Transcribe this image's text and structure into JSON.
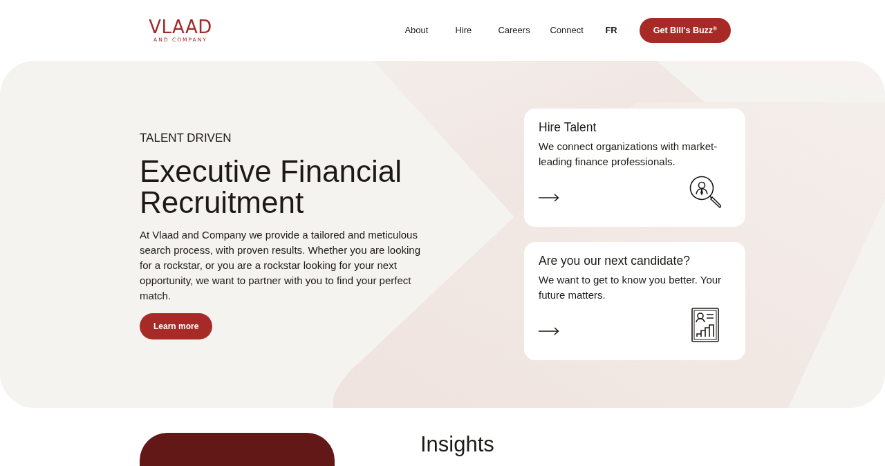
{
  "header": {
    "logo": {
      "name": "VLAAD",
      "tagline": "AND COMPANY"
    },
    "nav": [
      {
        "label": "About",
        "kind": "link"
      },
      {
        "label": "Hire",
        "kind": "link"
      },
      {
        "label": "Careers",
        "kind": "link"
      },
      {
        "label": "Connect",
        "kind": "link"
      },
      {
        "label": "FR",
        "kind": "language"
      }
    ],
    "cta": "Get Bill's Buzz$^{®}$"
  },
  "hero": {
    "eyebrow": "TALENT DRIVEN",
    "title": "Executive Financial Recruitment",
    "body": "At Vlaad and Company we provide a tailored and meticulous search process, with proven results. Whether you are looking for a rockstar, or you are a rockstar looking for your next opportunity, we want to partner with you to find your perfect match.",
    "button": "Learn more",
    "cards": [
      {
        "kind": "hire",
        "title": "Hire Talent",
        "text": "We connect organizations with market-leading finance professionals."
      },
      {
        "kind": "candidate",
        "title": "Are you our next candidate?",
        "text": "We want to get to know you better. Your future matters."
      }
    ]
  },
  "insights": {
    "title": "Insights"
  }
}
